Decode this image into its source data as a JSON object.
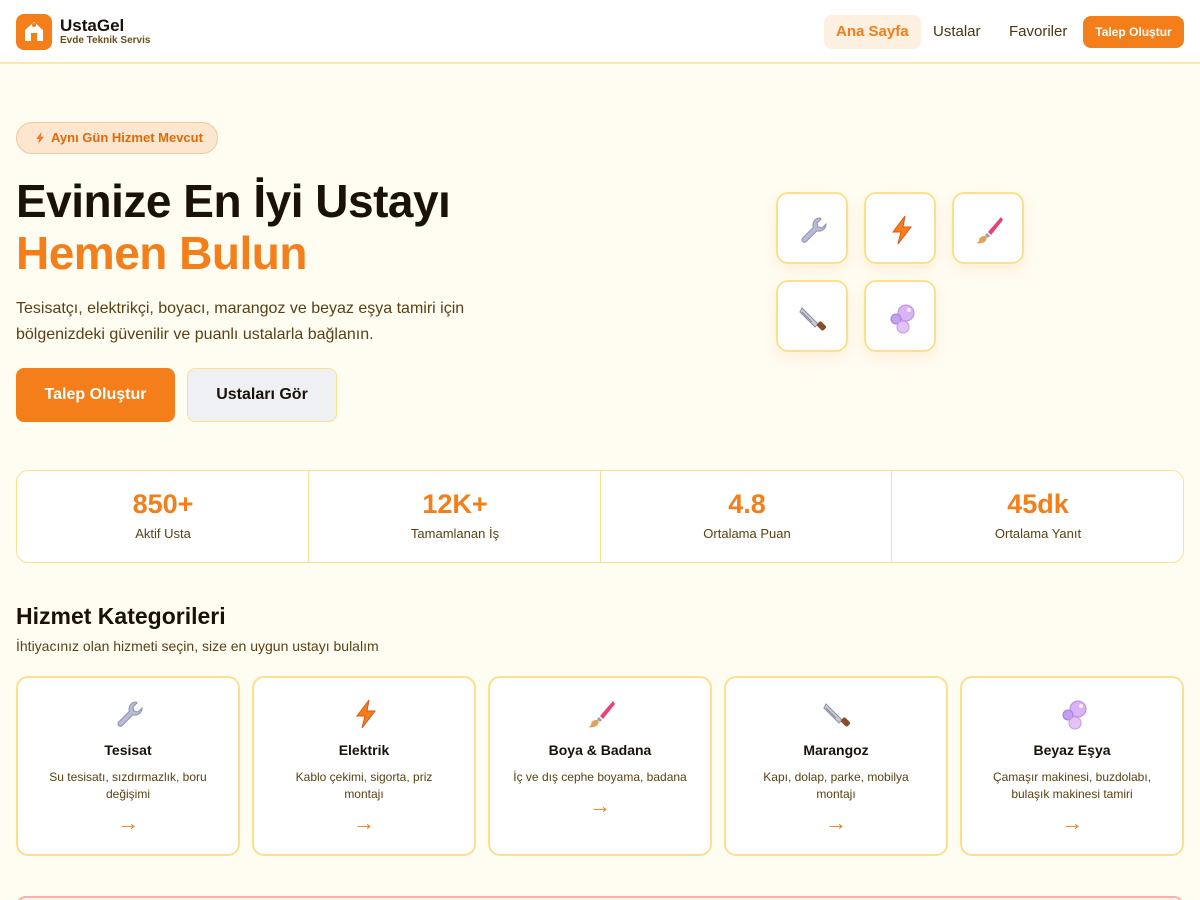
{
  "brand": {
    "name": "UstaGel",
    "tagline": "Evde Teknik Servis",
    "accent_color": "#f47e1a"
  },
  "nav": {
    "items": [
      {
        "label": "Ana Sayfa",
        "active": true
      },
      {
        "label": "Ustalar",
        "active": false
      },
      {
        "label": "Favoriler",
        "active": false
      }
    ],
    "cta_label": "Talep Oluştur"
  },
  "hero": {
    "badge": "Aynı Gün Hizmet Mevcut",
    "badge_icon": "lightning-icon",
    "title_line1": "Evinize En İyi Ustayı",
    "title_line2": "Hemen Bulun",
    "description": "Tesisatçı, elektrikçi, boyacı, marangoz ve beyaz eşya tamiri için bölgenizdeki güvenilir ve puanlı ustalarla bağlanın.",
    "primary_button": "Talep Oluştur",
    "secondary_button": "Ustaları Gör",
    "tile_icons": [
      "wrench-icon",
      "lightning-icon",
      "paintbrush-icon",
      "saw-icon",
      "bubbles-icon"
    ]
  },
  "stats": [
    {
      "value": "850+",
      "label": "Aktif Usta"
    },
    {
      "value": "12K+",
      "label": "Tamamlanan İş"
    },
    {
      "value": "4.8",
      "label": "Ortalama Puan"
    },
    {
      "value": "45dk",
      "label": "Ortalama Yanıt"
    }
  ],
  "categories": {
    "title": "Hizmet Kategorileri",
    "subtitle": "İhtiyacınız olan hizmeti seçin, size en uygun ustayı bulalım",
    "arrow": "→",
    "items": [
      {
        "icon": "wrench-icon",
        "name": "Tesisat",
        "description": "Su tesisatı, sızdırmazlık, boru değişimi"
      },
      {
        "icon": "lightning-icon",
        "name": "Elektrik",
        "description": "Kablo çekimi, sigorta, priz montajı"
      },
      {
        "icon": "paintbrush-icon",
        "name": "Boya & Badana",
        "description": "İç ve dış cephe boyama, badana"
      },
      {
        "icon": "saw-icon",
        "name": "Marangoz",
        "description": "Kapı, dolap, parke, mobilya montajı"
      },
      {
        "icon": "bubbles-icon",
        "name": "Beyaz Eşya",
        "description": "Çamaşır makinesi, buzdolabı, bulaşık makinesi tamiri"
      }
    ]
  }
}
